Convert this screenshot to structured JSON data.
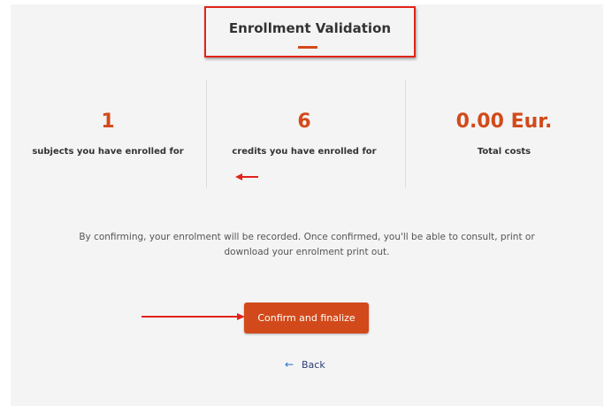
{
  "header": {
    "title": "Enrollment Validation"
  },
  "stats": [
    {
      "value": "1",
      "label": "subjects you have enrolled for"
    },
    {
      "value": "6",
      "label": "credits you have enrolled for"
    },
    {
      "value": "0.00 Eur.",
      "label": "Total costs"
    }
  ],
  "info": {
    "line1": "By confirming, your enrolment will be recorded. Once confirmed, you'll be able to consult, print or",
    "line2": "download your enrolment print out."
  },
  "actions": {
    "confirm_label": "Confirm and finalize",
    "back_label": "Back",
    "back_icon": "arrow-left-icon"
  },
  "colors": {
    "accent": "#d24a1b",
    "annotation_red": "#e2231a",
    "background": "#f4f4f4",
    "text": "#333333",
    "link": "#2c3e75"
  }
}
